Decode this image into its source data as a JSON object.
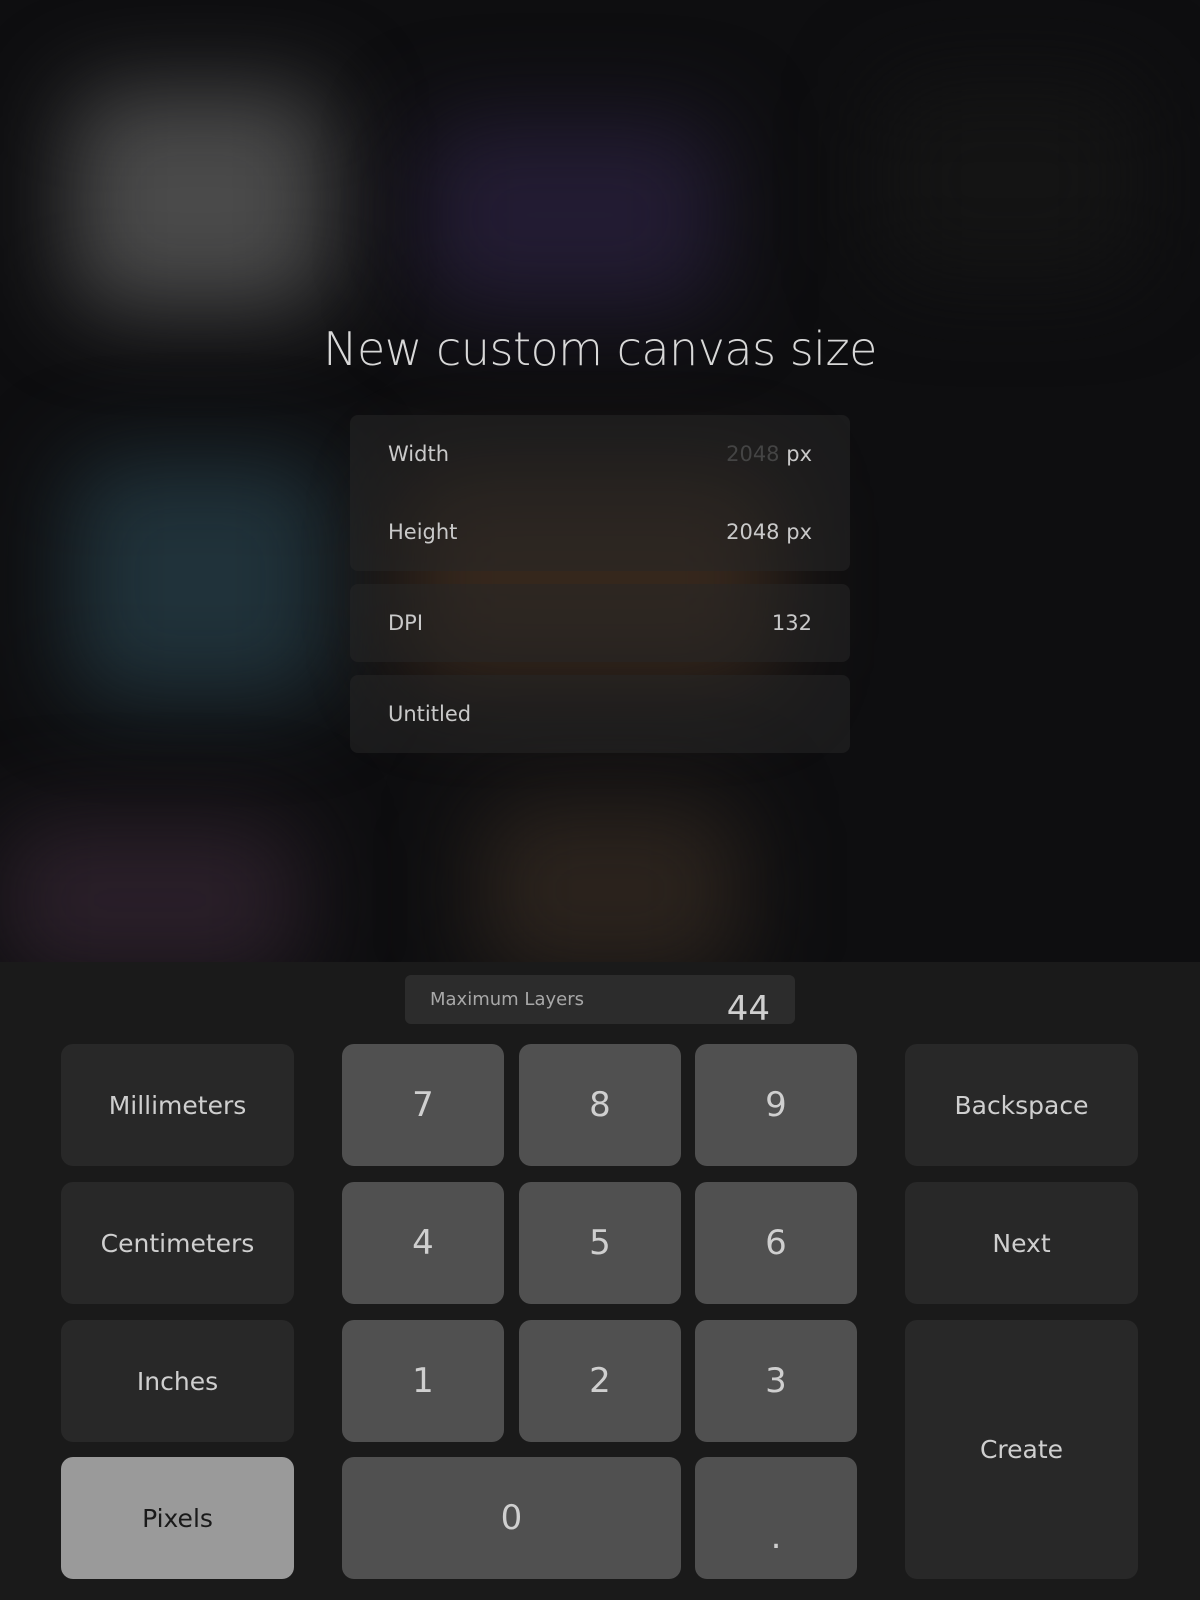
{
  "dialog": {
    "title": "New custom canvas size",
    "width": {
      "label": "Width",
      "value": "2048",
      "unit": "px"
    },
    "height": {
      "label": "Height",
      "value": "2048",
      "unit": "px"
    },
    "dpi": {
      "label": "DPI",
      "value": "132"
    },
    "name": {
      "value": "Untitled"
    }
  },
  "keyboard": {
    "max_layers": {
      "label": "Maximum Layers",
      "value": "44"
    },
    "units": [
      "Millimeters",
      "Centimeters",
      "Inches",
      "Pixels"
    ],
    "selected_unit": "Pixels",
    "digits": [
      "7",
      "8",
      "9",
      "4",
      "5",
      "6",
      "1",
      "2",
      "3",
      "0",
      "."
    ],
    "actions": {
      "backspace": "Backspace",
      "next": "Next",
      "create": "Create"
    }
  }
}
